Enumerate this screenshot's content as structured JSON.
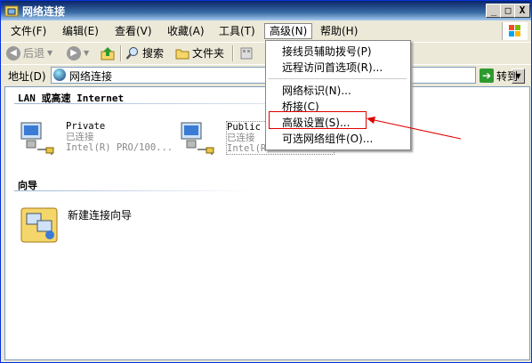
{
  "window": {
    "title": "网络连接"
  },
  "titlebar_buttons": [
    "_",
    "□",
    "X"
  ],
  "menus": [
    {
      "label": "文件(F)"
    },
    {
      "label": "编辑(E)"
    },
    {
      "label": "查看(V)"
    },
    {
      "label": "收藏(A)"
    },
    {
      "label": "工具(T)"
    },
    {
      "label": "高级(N)"
    },
    {
      "label": "帮助(H)"
    }
  ],
  "toolbar": {
    "back": "后退",
    "search": "搜索",
    "folders": "文件夹"
  },
  "address": {
    "label": "地址(D)",
    "value": "网络连接",
    "go": "转到"
  },
  "groups": {
    "lan": "LAN 或高速 Internet",
    "wizard": "向导"
  },
  "connections": [
    {
      "name": "Private",
      "status": "已连接",
      "device": "Intel(R) PRO/100..."
    },
    {
      "name": "Public",
      "status": "已连接",
      "device": "Intel(R) PRO/100..."
    }
  ],
  "wizard_item": {
    "label": "新建连接向导"
  },
  "dropdown": {
    "items": [
      "接线员辅助拨号(P)",
      "远程访问首选项(R)...",
      "网络标识(N)...",
      "桥接(C)",
      "高级设置(S)...",
      "可选网络组件(O)..."
    ]
  },
  "colors": {
    "highlight": "#e00000",
    "titlebar": "#0a246a"
  }
}
